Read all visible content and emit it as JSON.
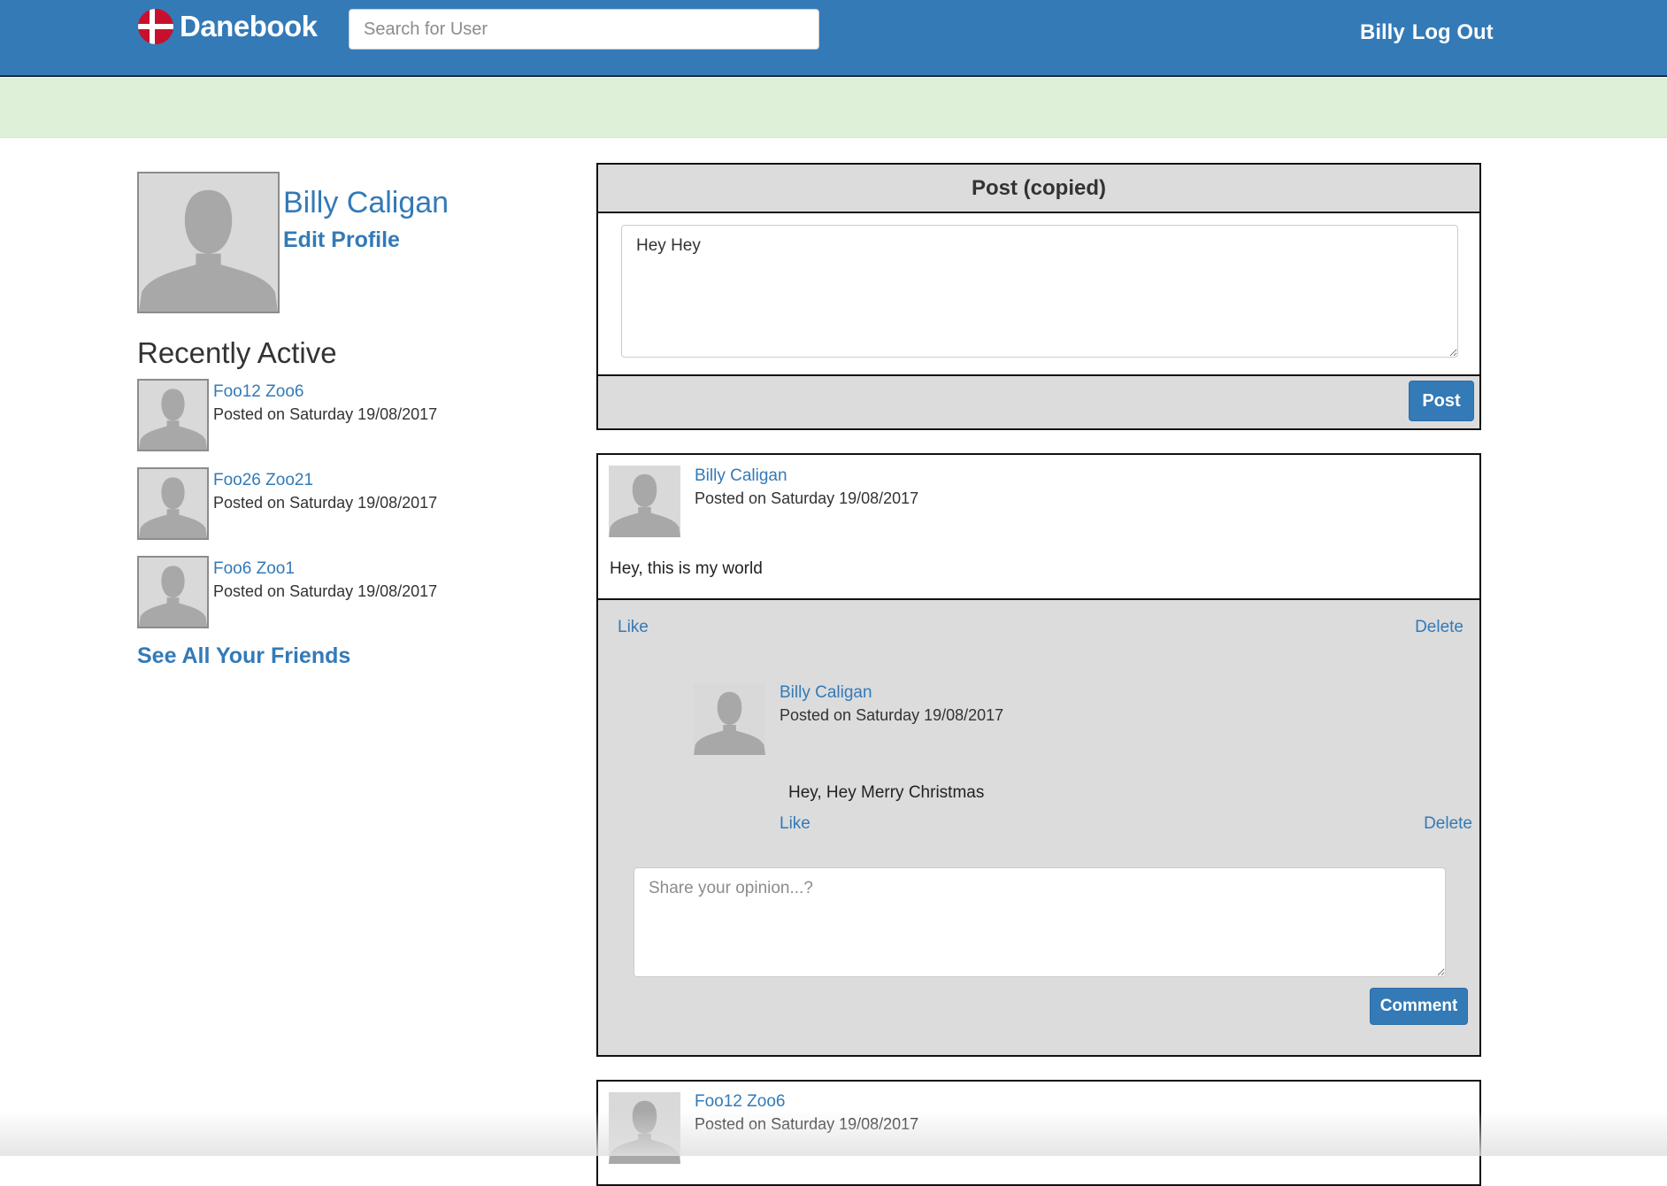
{
  "navbar": {
    "brand": "Danebook",
    "search_placeholder": "Search for User",
    "user_name": "Billy",
    "logout_label": "Log Out",
    "background": "#337ab7"
  },
  "profile": {
    "name": "Billy Caligan",
    "edit_label": "Edit Profile"
  },
  "recently_active": {
    "heading": "Recently Active",
    "items": [
      {
        "name": "Foo12 Zoo6",
        "date": "Posted on Saturday 19/08/2017"
      },
      {
        "name": "Foo26 Zoo21",
        "date": "Posted on Saturday 19/08/2017"
      },
      {
        "name": "Foo6 Zoo1",
        "date": "Posted on Saturday 19/08/2017"
      }
    ],
    "see_all_label": "See All Your Friends"
  },
  "composer": {
    "title": "Post (copied)",
    "text": "Hey Hey",
    "post_button": "Post"
  },
  "posts": [
    {
      "author": "Billy Caligan",
      "date": "Posted on Saturday 19/08/2017",
      "body": "Hey, this is my world",
      "like_label": "Like",
      "delete_label": "Delete",
      "comments": [
        {
          "author": "Billy Caligan",
          "date": "Posted on Saturday 19/08/2017",
          "body": "Hey, Hey Merry Christmas",
          "like_label": "Like",
          "delete_label": "Delete"
        }
      ],
      "comment_placeholder": "Share your opinion...?",
      "comment_button": "Comment"
    },
    {
      "author": "Foo12 Zoo6",
      "date": "Posted on Saturday 19/08/2017"
    }
  ],
  "colors": {
    "primary": "#337ab7",
    "success_band": "#dff0d8",
    "panel_gray": "#dcdcdc"
  },
  "icons": {
    "brand": "danish-flag-icon",
    "avatar": "default-user-silhouette-icon"
  }
}
